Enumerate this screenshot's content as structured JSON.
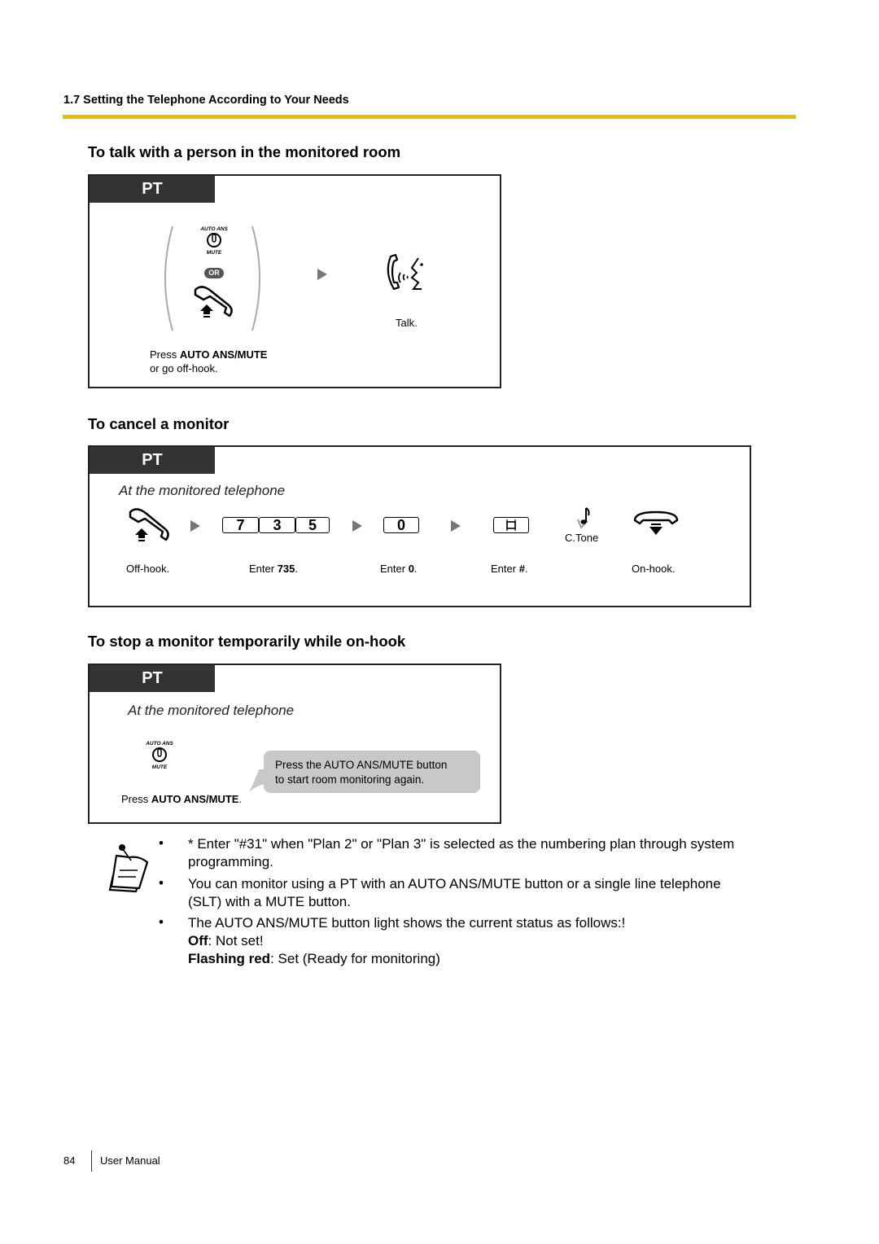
{
  "page": {
    "section_header": "1.7 Setting the Telephone According to Your Needs",
    "accent_color": "#dcc400",
    "page_number": "84",
    "footer_label": "User Manual"
  },
  "talk_section": {
    "title": "To talk with a person in the monitored room",
    "tab_label": "PT",
    "button_top_label": "AUTO ANS",
    "button_bottom_label": "MUTE",
    "or_label": "OR",
    "step1_caption_prefix": "Press ",
    "step1_caption_bold": "AUTO ANS/MUTE",
    "step1_caption_line2": "or go off-hook.",
    "step2_caption": "Talk."
  },
  "cancel_section": {
    "title": "To cancel a monitor",
    "tab_label": "PT",
    "note": "At the monitored telephone",
    "keys_735": [
      "7",
      "3",
      "5"
    ],
    "key_0": "0",
    "ctone_label": "C.Tone",
    "captions": {
      "offhook": "Off-hook.",
      "enter735_prefix": "Enter ",
      "enter735_bold": "735",
      "enter0_prefix": "Enter ",
      "enter0_bold": "0",
      "enterhash_prefix": "Enter ",
      "enterhash_bold": "#",
      "period": ".",
      "onhook": "On-hook."
    }
  },
  "stop_section": {
    "title": "To stop a monitor temporarily while on-hook",
    "tab_label": "PT",
    "note": "At the monitored telephone",
    "button_top_label": "AUTO ANS",
    "button_bottom_label": "MUTE",
    "caption_prefix": "Press ",
    "caption_bold": "AUTO ANS/MUTE",
    "caption_suffix": ".",
    "bubble_line1": "Press the AUTO ANS/MUTE button",
    "bubble_line2": "to start room monitoring again."
  },
  "notes": {
    "bullet_char": "•",
    "items": [
      {
        "line1": "* Enter \"#31\" when \"Plan 2\" or \"Plan 3\" is selected as the numbering plan through system",
        "line2": "programming."
      },
      {
        "line1": "You can monitor using a PT with an AUTO ANS/MUTE button or a single line telephone",
        "line2": "(SLT) with a MUTE button."
      },
      {
        "line1": "The AUTO ANS/MUTE button light shows the current status as follows:!",
        "off_bold": "Off",
        "off_text": ": Not set!",
        "flash_bold": "Flashing red",
        "flash_text": ": Set (Ready for monitoring)"
      }
    ]
  }
}
